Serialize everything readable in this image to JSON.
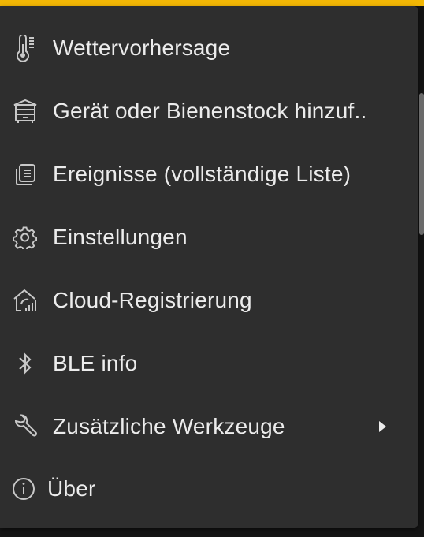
{
  "colors": {
    "accent": "#f2b705",
    "menu_background": "#2e2e2e",
    "text": "#ececec",
    "icon": "#c8c8c8"
  },
  "menu": {
    "items": [
      {
        "label": "Wettervorhersage",
        "icon": "thermometer-icon"
      },
      {
        "label": "Gerät oder Bienenstock hinzuf..",
        "icon": "beehive-icon"
      },
      {
        "label": "Ereignisse (vollständige Liste)",
        "icon": "event-list-icon"
      },
      {
        "label": "Einstellungen",
        "icon": "gear-icon"
      },
      {
        "label": "Cloud-Registrierung",
        "icon": "home-signal-icon"
      },
      {
        "label": "BLE info",
        "icon": "bluetooth-icon"
      },
      {
        "label": "Zusätzliche Werkzeuge",
        "icon": "wrench-icon",
        "has_submenu": true
      },
      {
        "label": "Über",
        "icon": "info-icon"
      }
    ]
  }
}
